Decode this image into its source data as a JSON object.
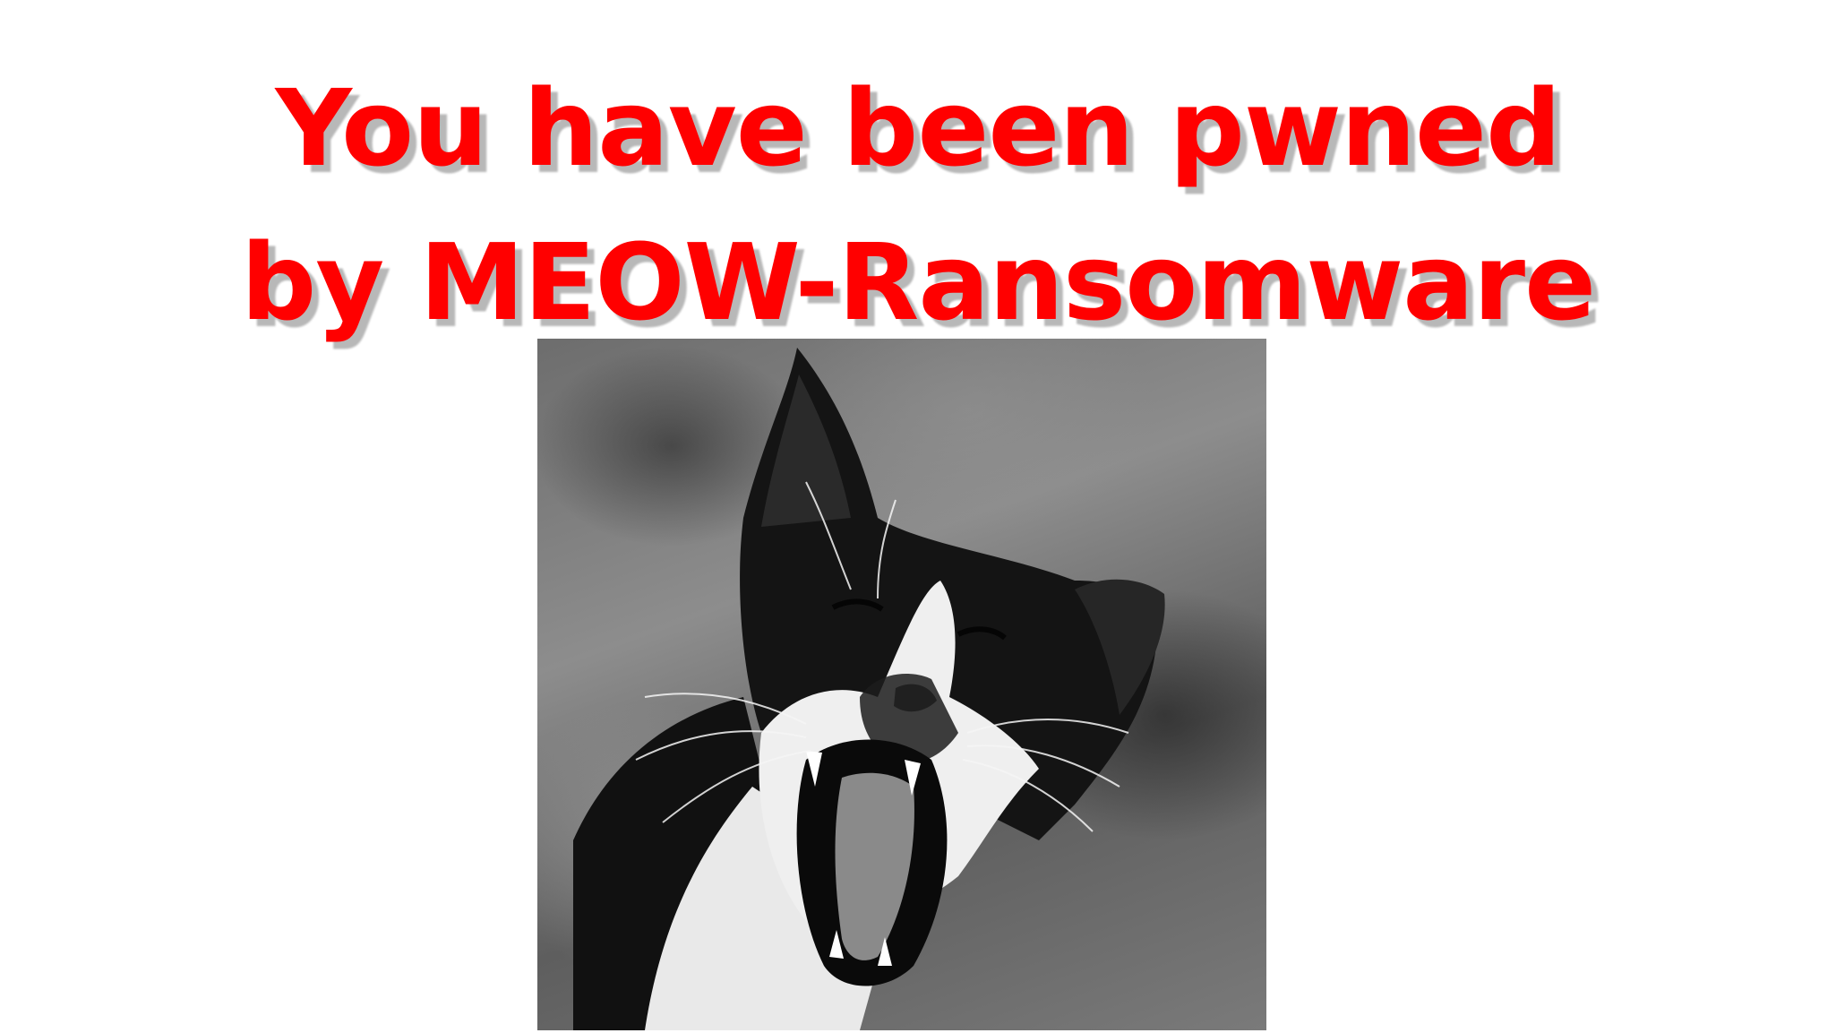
{
  "headline": {
    "line1": "You have been pwned",
    "line2": "by MEOW-Ransomware",
    "color": "#ff0000",
    "shadow_color": "#b8b8b8"
  },
  "photo": {
    "subject": "black-and-white photo of a hissing cat with open mouth",
    "style": "grayscale"
  }
}
